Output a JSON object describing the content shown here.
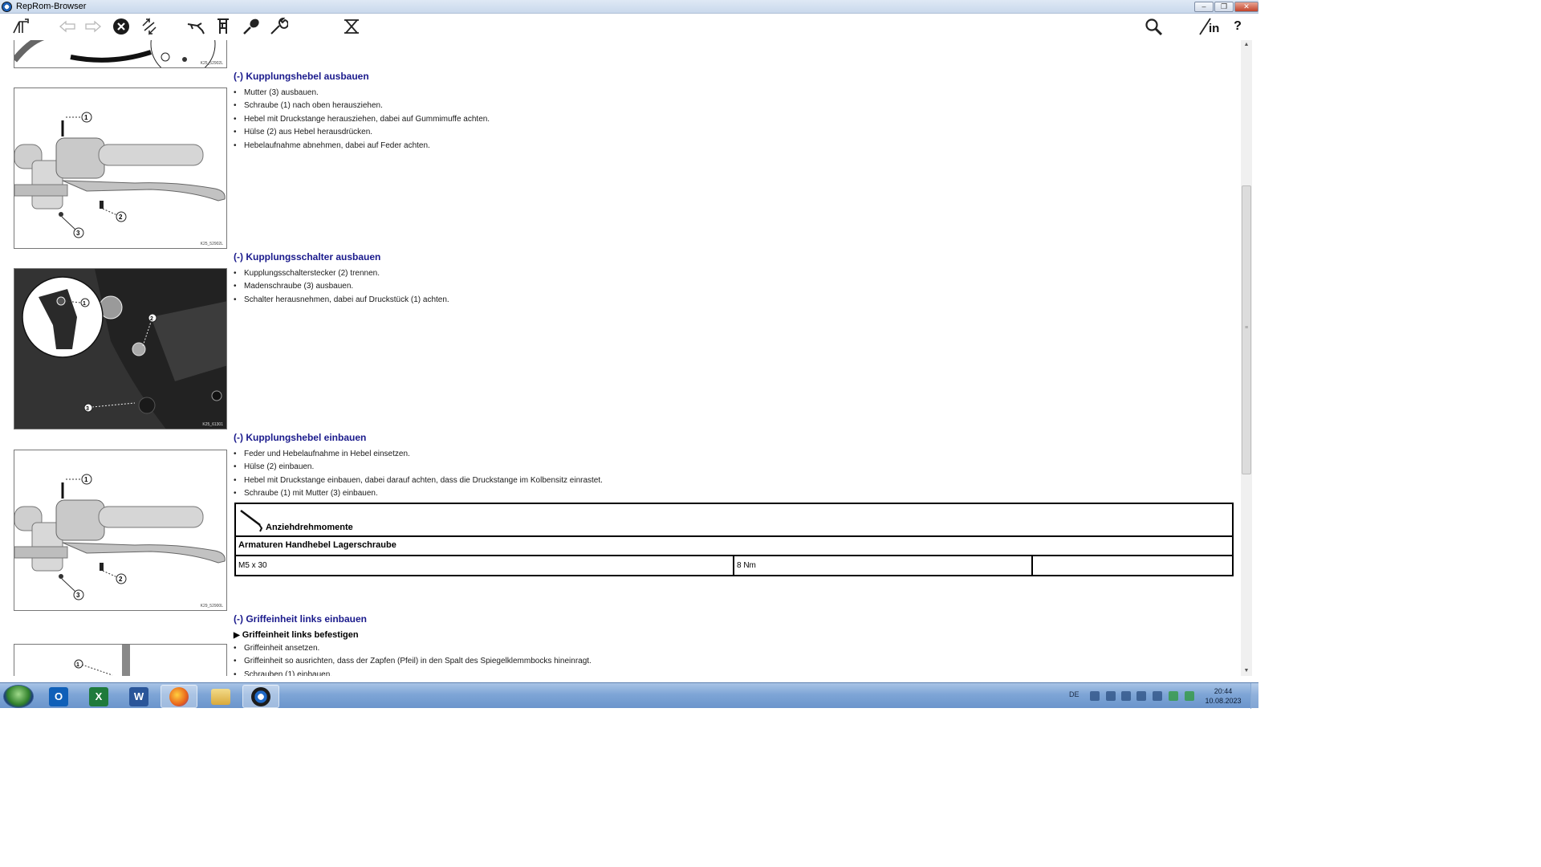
{
  "window": {
    "title": "RepRom-Browser",
    "controls": {
      "minimize": "–",
      "restore": "❐",
      "close": "✕"
    }
  },
  "toolbar": {
    "icons": [
      "navigation-tree-icon",
      "back-arrow-icon",
      "forward-arrow-icon",
      "cancel-icon",
      "sync-icon",
      "tool-icon",
      "measurement-icon",
      "adjust-icon",
      "wrench-icon",
      "filter-icon",
      "search-icon",
      "info-icon",
      "help-icon"
    ],
    "info_label": "in",
    "help_label": "?"
  },
  "sections": [
    {
      "title": "(-) Kupplungshebel ausbauen",
      "figure_code": "K25_52902L",
      "steps": [
        "Mutter (3) ausbauen.",
        "Schraube (1) nach oben herausziehen.",
        "Hebel mit Druckstange herausziehen, dabei auf Gummimuffe achten.",
        "Hülse (2) aus Hebel herausdrücken.",
        "Hebelaufnahme abnehmen, dabei auf Feder achten."
      ]
    },
    {
      "title": "(-) Kupplungsschalter ausbauen",
      "figure_code": "K25_61301",
      "steps": [
        "Kupplungsschalterstecker (2) trennen.",
        "Madenschraube (3) ausbauen.",
        "Schalter herausnehmen, dabei auf Druckstück (1) achten."
      ]
    },
    {
      "title": "(-) Kupplungshebel einbauen",
      "figure_code": "K29_52900L",
      "steps": [
        "Feder und Hebelaufnahme in Hebel einsetzen.",
        "Hülse (2) einbauen.",
        "Hebel mit Druckstange einbauen, dabei darauf achten, dass die Druckstange im Kolbensitz einrastet.",
        "Schraube (1) mit Mutter (3) einbauen."
      ],
      "torque_table": {
        "header": "Anziehdrehmomente",
        "subheader": "Armaturen Handhebel Lagerschraube",
        "row": {
          "spec": "M5 x 30",
          "value": "8 Nm",
          "note": ""
        }
      }
    },
    {
      "title": "(-) Griffeinheit links einbauen",
      "subhead": "Griffeinheit links befestigen",
      "steps": [
        "Griffeinheit ansetzen.",
        "Griffeinheit so ausrichten, dass der Zapfen (Pfeil) in den Spalt des Spiegelklemmbocks hineinragt.",
        "Schrauben (1) einbauen."
      ]
    }
  ],
  "top_figure_code": "K25_52902L",
  "callouts": [
    "1",
    "2",
    "3"
  ],
  "taskbar": {
    "apps": [
      {
        "name": "outlook",
        "glyph": "O",
        "color": "#0f5fb8"
      },
      {
        "name": "excel",
        "glyph": "X",
        "color": "#1f7a3c"
      },
      {
        "name": "word",
        "glyph": "W",
        "color": "#2a5599"
      },
      {
        "name": "firefox",
        "glyph": "",
        "color": "#e8631c"
      },
      {
        "name": "explorer",
        "glyph": "",
        "color": "#e7c35a"
      },
      {
        "name": "bmw",
        "glyph": "",
        "color": "#1c1c1c"
      }
    ],
    "language": "DE",
    "time": "20:44",
    "date": "10.08.2023"
  }
}
